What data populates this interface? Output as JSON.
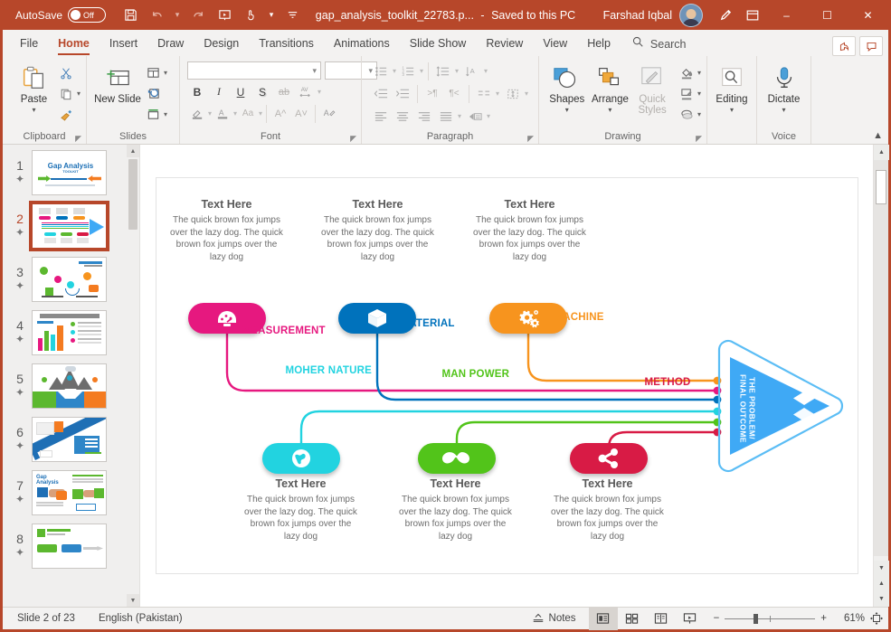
{
  "titlebar": {
    "autosave_label": "AutoSave",
    "autosave_state": "Off",
    "document_title": "gap_analysis_toolkit_22783.p...",
    "separator": "-",
    "save_state": "Saved to this PC",
    "user_name": "Farshad Iqbal",
    "icons": [
      "save-icon",
      "undo-icon",
      "redo-icon",
      "present-icon",
      "touch-mode-icon",
      "customize-qat-icon"
    ],
    "window_minimize": "–",
    "window_maximize": "☐",
    "window_close": "✕"
  },
  "tabs": {
    "items": [
      {
        "label": "File",
        "active": false
      },
      {
        "label": "Home",
        "active": true
      },
      {
        "label": "Insert",
        "active": false
      },
      {
        "label": "Draw",
        "active": false
      },
      {
        "label": "Design",
        "active": false
      },
      {
        "label": "Transitions",
        "active": false
      },
      {
        "label": "Animations",
        "active": false
      },
      {
        "label": "Slide Show",
        "active": false
      },
      {
        "label": "Review",
        "active": false
      },
      {
        "label": "View",
        "active": false
      },
      {
        "label": "Help",
        "active": false
      }
    ],
    "search_placeholder": "Search",
    "share_label": "share-icon",
    "comments_label": "comments-icon"
  },
  "ribbon": {
    "groups": [
      {
        "name": "Clipboard",
        "label": "Clipboard",
        "main_button": "Paste"
      },
      {
        "name": "Slides",
        "label": "Slides",
        "main_button": "New Slide"
      },
      {
        "name": "Font",
        "label": "Font",
        "font_value": "",
        "size_value": ""
      },
      {
        "name": "Paragraph",
        "label": "Paragraph"
      },
      {
        "name": "Drawing",
        "label": "Drawing",
        "buttons": [
          "Shapes",
          "Arrange",
          "Quick Styles"
        ]
      },
      {
        "name": "Editing",
        "label": "",
        "main_button": "Editing"
      },
      {
        "name": "Voice",
        "label": "Voice",
        "main_button": "Dictate"
      }
    ],
    "font_buttons": [
      "B",
      "I",
      "U",
      "S",
      "ab",
      "AV"
    ],
    "shapes_label": "Shapes",
    "arrange_label": "Arrange",
    "quickstyles_label": "Quick Styles",
    "editing_label": "Editing",
    "dictate_label": "Dictate",
    "paste_label": "Paste",
    "newslide_label": "New Slide",
    "collapse_icon": "collapse-ribbon-icon"
  },
  "thumbnails": {
    "slides": [
      {
        "number": "1",
        "selected": false
      },
      {
        "number": "2",
        "selected": true
      },
      {
        "number": "3",
        "selected": false
      },
      {
        "number": "4",
        "selected": false
      },
      {
        "number": "5",
        "selected": false
      },
      {
        "number": "6",
        "selected": false
      },
      {
        "number": "7",
        "selected": false
      },
      {
        "number": "8",
        "selected": false
      }
    ],
    "slide1_title": "Gap Analysis",
    "slide1_sub": "TOOLKIT"
  },
  "slide": {
    "diagram_type": "fishbone",
    "outcome_label": "THE PROBLEM/\nFINAL OUTCOME",
    "outcome_line1": "THE PROBLEM/",
    "outcome_line2": "FINAL OUTCOME",
    "body_text": "The quick brown fox jumps over the lazy dog. The quick brown fox jumps over the lazy dog",
    "heading_text": "Text Here",
    "branches": [
      {
        "category": "MEASUREMENT",
        "color": "#e6187f",
        "icon": "gauge-icon",
        "position": "top",
        "heading": "Text Here"
      },
      {
        "category": "MATERIAL",
        "color": "#0079c2",
        "icon": "cube-icon",
        "position": "top",
        "heading": "Text Here"
      },
      {
        "category": "MACHINE",
        "color": "#f7941e",
        "icon": "gears-icon",
        "position": "top",
        "heading": "Text Here"
      },
      {
        "category": "MOHER NATURE",
        "color": "#22ccdd",
        "icon": "globe-icon",
        "position": "bottom",
        "heading": "Text Here"
      },
      {
        "category": "MAN POWER",
        "color": "#49c järn",
        "icon": "moustache-icon",
        "position": "bottom",
        "heading": "Text Here"
      },
      {
        "category": "METHOD",
        "color": "#d81b45",
        "icon": "share-nodes-icon",
        "position": "bottom",
        "heading": "Text Here"
      }
    ],
    "colors": {
      "measurement": "#e6187f",
      "material": "#0072bc",
      "machine": "#f7941e",
      "moher_nature": "#22d3e0",
      "man_power": "#4cc party",
      "method": "#d81b45",
      "arrow": "#3fa9f5"
    }
  },
  "status": {
    "slide_position": "Slide 2 of 23",
    "language": "English (Pakistan)",
    "notes_label": "Notes",
    "views": [
      "normal-view-icon",
      "slide-sorter-icon",
      "reading-view-icon",
      "slideshow-icon"
    ],
    "zoom_minus": "−",
    "zoom_plus": "+",
    "zoom_level": "61%",
    "fit_icon": "fit-slide-icon"
  }
}
